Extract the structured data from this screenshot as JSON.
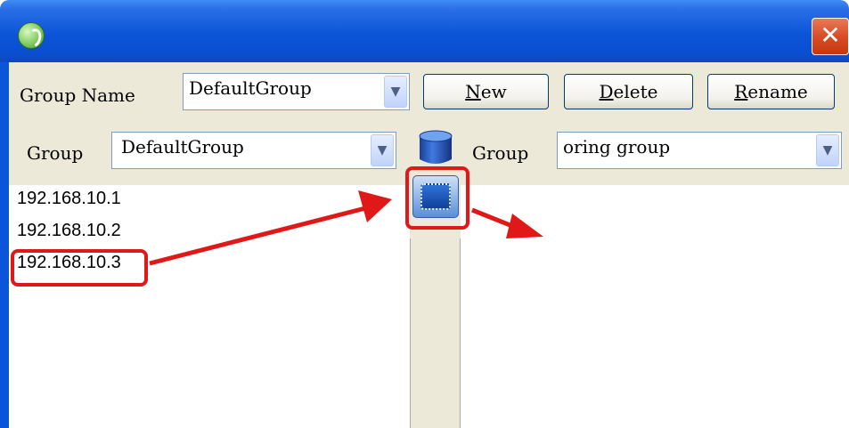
{
  "window": {
    "close_glyph": "✕",
    "accent_color": "#0b55d8"
  },
  "group_name_row": {
    "label": "Group Name",
    "combo_value": "DefaultGroup",
    "buttons": {
      "new": {
        "mnemonic": "N",
        "rest": "ew"
      },
      "delete": {
        "mnemonic": "D",
        "rest": "elete"
      },
      "rename": {
        "mnemonic": "R",
        "rest": "ename"
      }
    }
  },
  "left_group": {
    "label": "Group",
    "combo_value": "DefaultGroup",
    "devices": [
      "192.168.10.1",
      "192.168.10.2",
      "192.168.10.3"
    ]
  },
  "right_group": {
    "label": "Group",
    "combo_value": "oring group"
  },
  "icons": {
    "app": "app-icon",
    "database": "database-icon",
    "move": "move-to-group-icon",
    "dropdown": "chevron-down-icon"
  },
  "annotation_color": "#e01818"
}
